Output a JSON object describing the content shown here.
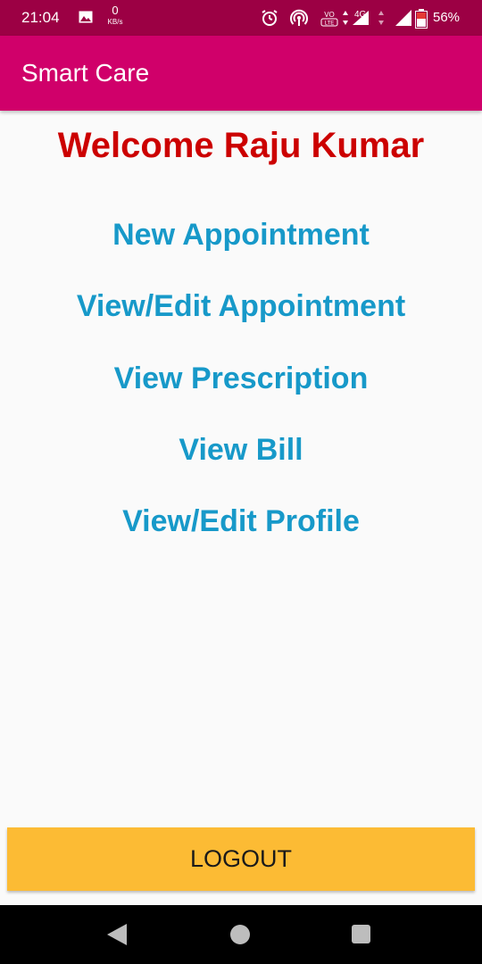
{
  "status_bar": {
    "time": "21:04",
    "network_speed_value": "0",
    "network_speed_unit": "KB/s",
    "network_type": "4G",
    "volte_label": "VoLTE",
    "battery_percent": "56%"
  },
  "app_bar": {
    "title": "Smart Care"
  },
  "main": {
    "welcome_text": "Welcome Raju Kumar",
    "menu": [
      {
        "label": "New Appointment"
      },
      {
        "label": "View/Edit Appointment"
      },
      {
        "label": "View Prescription"
      },
      {
        "label": "View Bill"
      },
      {
        "label": "View/Edit Profile"
      }
    ]
  },
  "logout": {
    "label": "LOGOUT"
  },
  "colors": {
    "status_bar": "#9c0044",
    "app_bar": "#d0006a",
    "welcome": "#cc0000",
    "menu_link": "#1799c9",
    "logout_button": "#fcbb34"
  },
  "icons": {
    "status_left": [
      "image-icon"
    ],
    "status_right": [
      "alarm-icon",
      "hotspot-icon",
      "volte-icon",
      "data-arrows-icon",
      "signal-icon",
      "battery-icon"
    ],
    "nav": [
      "back-icon",
      "home-icon",
      "recents-icon"
    ]
  }
}
